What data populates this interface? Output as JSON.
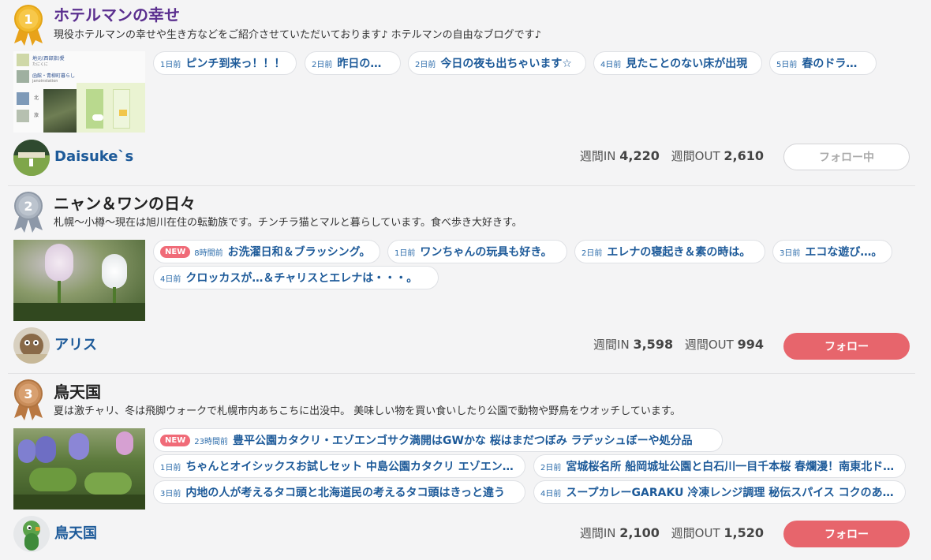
{
  "colors": {
    "accent_title_1": "#5b2f8f",
    "link_blue": "#1d5a99",
    "follow_red": "#e7656c",
    "new_badge": "#f06b78",
    "gold": "#e6a817",
    "silver": "#9aa3b0",
    "bronze": "#c08050"
  },
  "labels": {
    "weekly_in": "週間IN",
    "weekly_out": "週間OUT",
    "new": "NEW"
  },
  "entries": [
    {
      "rank": "1",
      "title": "ホテルマンの幸せ",
      "description": "現役ホテルマンの幸せや生き方などをご紹介させていただいております♪ ホテルマンの自由なブログです♪",
      "thumb_text": {
        "l1": "地元(西部旅)愛",
        "l2": "たにくに",
        "l3": "函館・青柳町暮らし",
        "l4": "janoinstation",
        "l5": "北",
        "l6": "旅"
      },
      "posts": [
        {
          "ago": "1日前",
          "title": "ピンチ到来っ！！！"
        },
        {
          "ago": "2日前",
          "title": "昨日の休日"
        },
        {
          "ago": "2日前",
          "title": "今日の夜も出ちゃいます☆"
        },
        {
          "ago": "4日前",
          "title": "見たことのない床が出現"
        },
        {
          "ago": "5日前",
          "title": "春のドライブ"
        }
      ],
      "author": "Daisuke`s",
      "in": "4,220",
      "out": "2,610",
      "follow_label": "フォロー中"
    },
    {
      "rank": "2",
      "title": "ニャン＆ワンの日々",
      "description": "札幌〜小樽〜現在は旭川在住の転勤族です。チンチラ猫とマルと暮らしています。食べ歩き大好きす。",
      "posts": [
        {
          "ago": "8時間前",
          "title": "お洗濯日和＆ブラッシング。"
        },
        {
          "ago": "1日前",
          "title": "ワンちゃんの玩具も好き。"
        },
        {
          "ago": "2日前",
          "title": "エレナの寝起き＆素の時は。"
        },
        {
          "ago": "3日前",
          "title": "エコな遊び…。"
        },
        {
          "ago": "4日前",
          "title": "クロッカスが…＆チャリスとエレナは・・・。"
        }
      ],
      "author": "アリス",
      "in": "3,598",
      "out": "994",
      "follow_label": "フォロー"
    },
    {
      "rank": "3",
      "title": "鳥天国",
      "description": "夏は激チャリ、冬は飛脚ウォークで札幌市内あちこちに出没中。 美味しい物を買い食いしたり公園で動物や野鳥をウオッチしています。",
      "posts": [
        {
          "ago": "23時間前",
          "title": "豊平公園カタクリ・エゾエンゴサク満開はGWかな 桜はまだつぼみ ラデッシュぼーや処分品"
        },
        {
          "ago": "1日前",
          "title": "ちゃんとオイシックスお試しセット 中島公園カタクリ エゾエンゴサク"
        },
        {
          "ago": "2日前",
          "title": "宮城桜名所 船岡城址公園と白石川一目千本桜 春爛漫！南東北ドライブ"
        },
        {
          "ago": "3日前",
          "title": "内地の人が考えるタコ頭と北海道民の考えるタコ頭はきっと違う"
        },
        {
          "ago": "4日前",
          "title": "スープカレーGARAKU 冷凍レンジ調理 秘伝スパイス コクのあるスープ"
        }
      ],
      "author": "鳥天国",
      "in": "2,100",
      "out": "1,520",
      "follow_label": "フォロー"
    }
  ]
}
